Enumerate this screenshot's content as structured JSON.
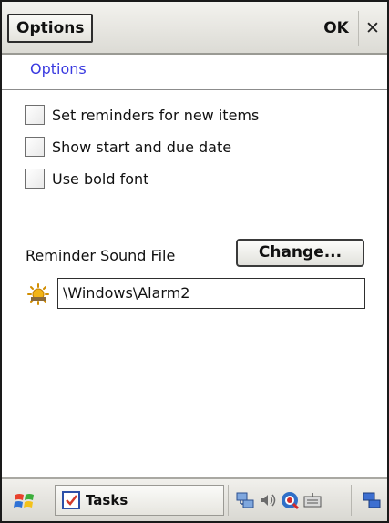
{
  "window": {
    "title": "Options",
    "ok_label": "OK",
    "close_label": "✕"
  },
  "tab": {
    "label": "Options"
  },
  "options": {
    "checkboxes": [
      {
        "label": "Set reminders for new items",
        "checked": false
      },
      {
        "label": "Show start and due date",
        "checked": false
      },
      {
        "label": "Use bold font",
        "checked": false
      }
    ]
  },
  "sound": {
    "label": "Reminder Sound File",
    "change_label": "Change...",
    "file_value": "\\Windows\\Alarm2",
    "icon": "sun-icon"
  },
  "taskbar": {
    "start_icon": "windows-flag-icon",
    "task_label": "Tasks",
    "tray_icons": [
      "network-icon",
      "volume-icon",
      "sync-icon",
      "keyboard-icon",
      "input-panel-icon"
    ]
  },
  "colors": {
    "tab_link": "#3a3ae0",
    "titlebar_bg": "#e6e5e0",
    "sun_icon": "#f2b416"
  }
}
